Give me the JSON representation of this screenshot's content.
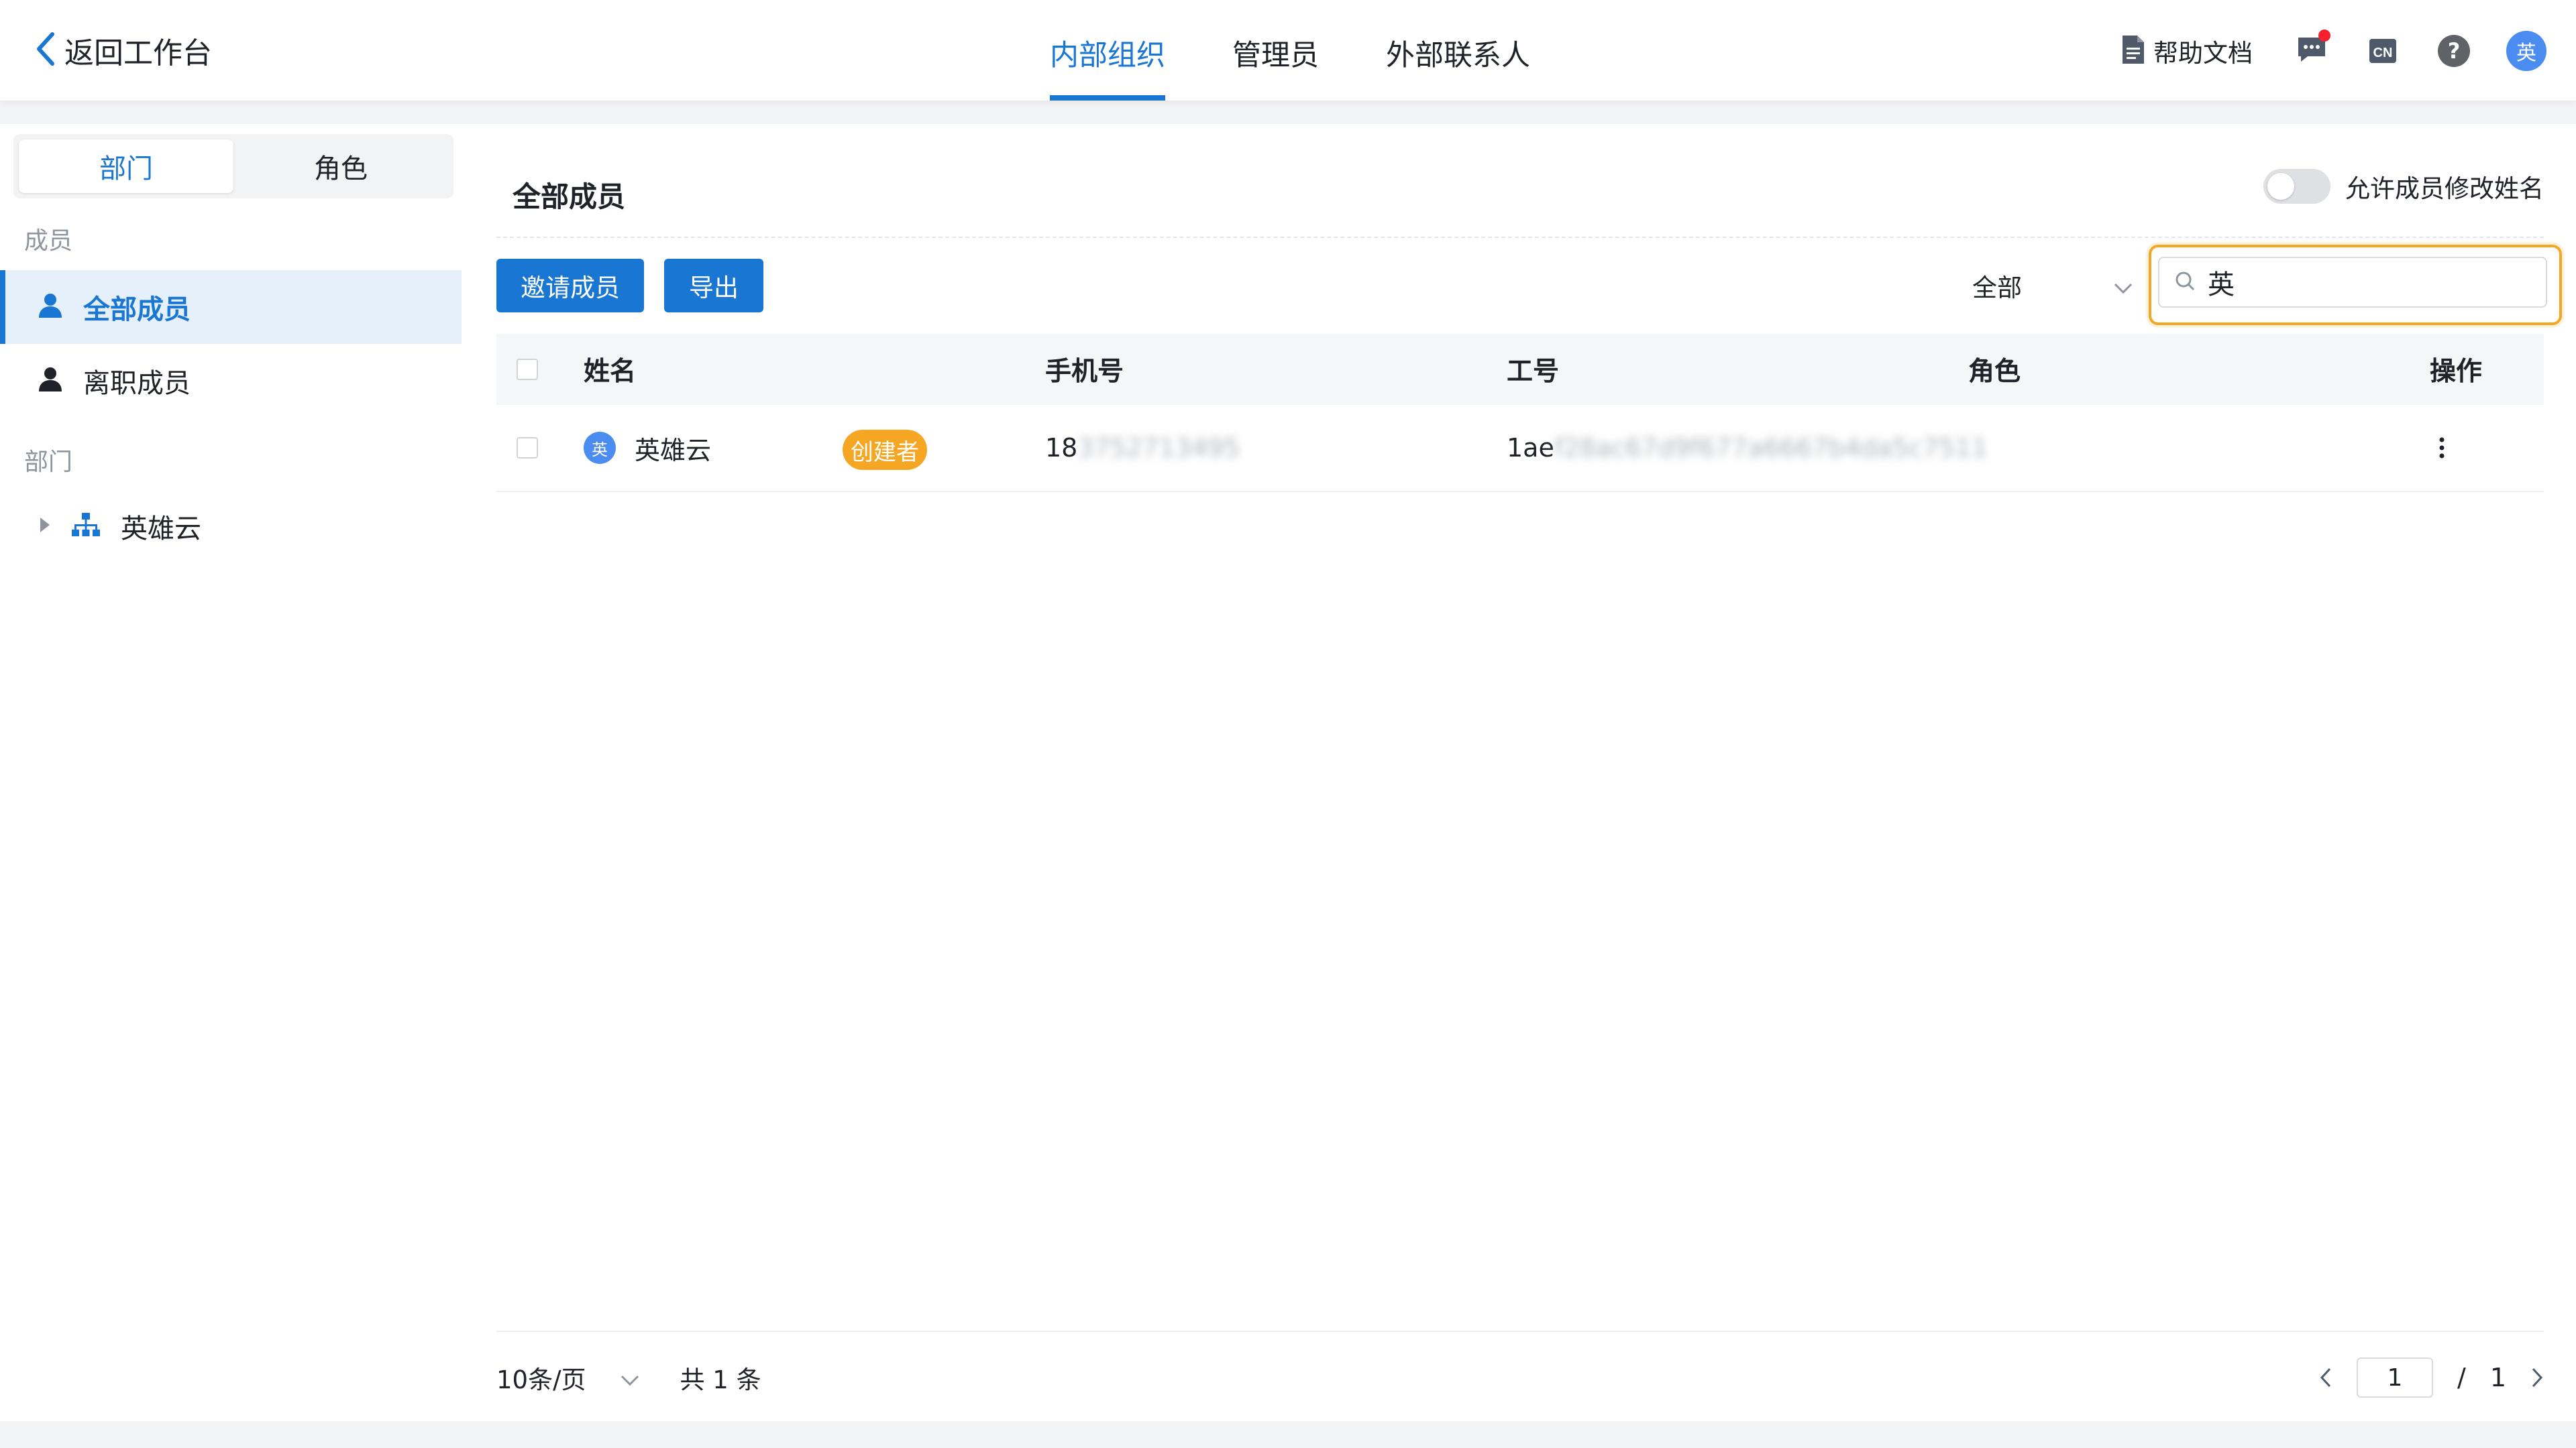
{
  "header": {
    "back_label": "返回工作台",
    "tabs": [
      {
        "label": "内部组织",
        "active": true
      },
      {
        "label": "管理员",
        "active": false
      },
      {
        "label": "外部联系人",
        "active": false
      }
    ],
    "help_label": "帮助文档",
    "lang_label": "CN",
    "help_icon_text": "?",
    "avatar_text": "英"
  },
  "sidebar": {
    "seg_tabs": [
      {
        "label": "部门",
        "active": true
      },
      {
        "label": "角色",
        "active": false
      }
    ],
    "members_section": "成员",
    "member_items": [
      {
        "label": "全部成员",
        "active": true
      },
      {
        "label": "离职成员",
        "active": false
      }
    ],
    "dept_section": "部门",
    "dept_tree": [
      {
        "label": "英雄云"
      }
    ]
  },
  "main": {
    "title": "全部成员",
    "allow_rename_label": "允许成员修改姓名",
    "allow_rename_on": false,
    "invite_label": "邀请成员",
    "export_label": "导出",
    "filter_value": "全部",
    "search_value": "英",
    "columns": [
      "姓名",
      "手机号",
      "工号",
      "角色",
      "操作"
    ],
    "rows": [
      {
        "avatar": "英",
        "name": "英雄云",
        "badge": "创建者",
        "phone_visible": "18",
        "phone_hidden": "3752713495",
        "emp_visible": "1ae",
        "emp_hidden": "f28ac67d9f677a6667b4da5c7511",
        "role": ""
      }
    ]
  },
  "pagination": {
    "page_size_label": "10条/页",
    "total_label": "共 1 条",
    "current_page": "1",
    "separator": "/",
    "total_pages": "1"
  },
  "colors": {
    "primary": "#1976d2",
    "badge": "#f5a623",
    "notify_dot": "#f5222d"
  }
}
